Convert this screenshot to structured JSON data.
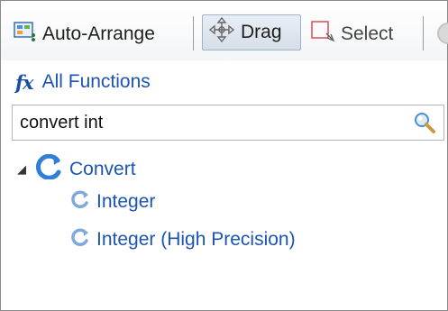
{
  "toolbar": {
    "auto_arrange_label": "Auto-Arrange",
    "drag_label": "Drag",
    "select_label": "Select"
  },
  "functions": {
    "fx_symbol": "fx",
    "category_label": "All Functions"
  },
  "search": {
    "value": "convert int"
  },
  "tree": {
    "group": {
      "label": "Convert",
      "expanded": true,
      "children": [
        {
          "label": "Integer"
        },
        {
          "label": "Integer (High Precision)"
        }
      ]
    }
  },
  "colors": {
    "link_blue": "#1c54b5",
    "icon_blue": "#2f7fd6"
  }
}
